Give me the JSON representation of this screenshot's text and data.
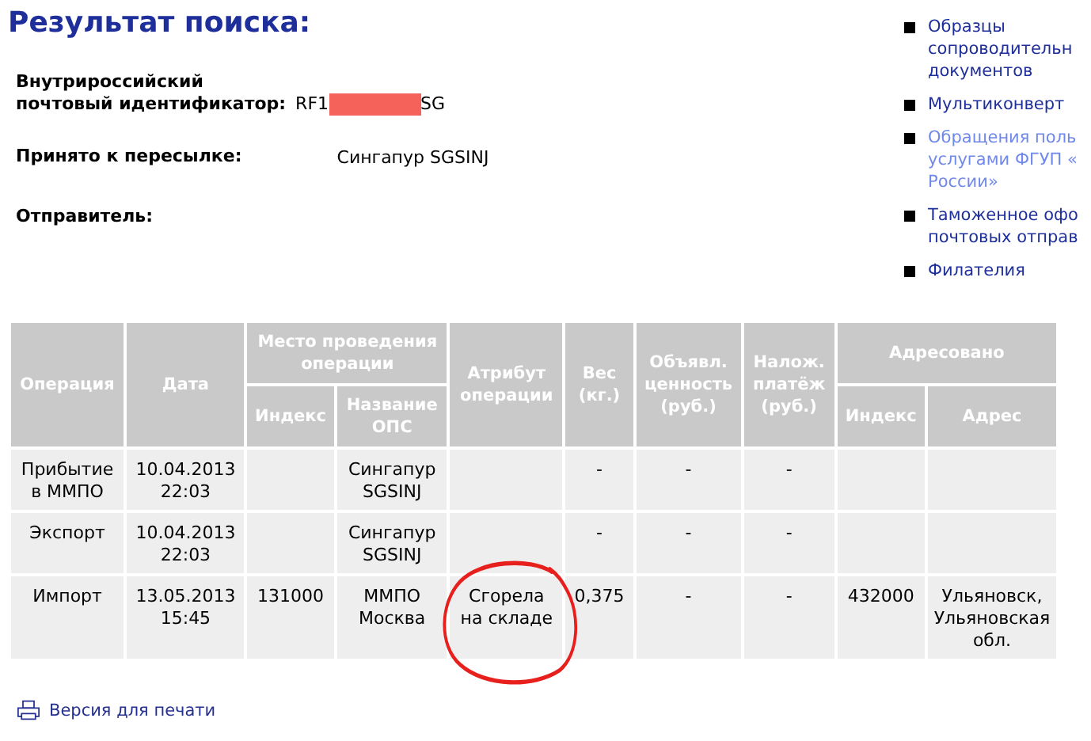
{
  "title": "Результат поиска:",
  "identifier": {
    "label": "Внутрироссийский\nпочтовый идентификатор:",
    "prefix": "RF1",
    "suffix": "SG"
  },
  "accepted": {
    "label": "Принято к пересылке:",
    "value": "Сингапур SGSINJ"
  },
  "sender": {
    "label": "Отправитель:"
  },
  "table": {
    "columns": [
      {
        "label": "Операция",
        "grouped": false
      },
      {
        "label": "Дата",
        "grouped": false
      },
      {
        "label": "Индекс",
        "grouped": true
      },
      {
        "label": "Название\nОПС",
        "grouped": true
      },
      {
        "label": "Атрибут\nоперации",
        "grouped": false
      },
      {
        "label": "Вес\n(кг.)",
        "grouped": false
      },
      {
        "label": "Объявл.\nценность\n(руб.)",
        "grouped": false
      },
      {
        "label": "Налож.\nплатёж\n(руб.)",
        "grouped": false
      },
      {
        "label": "Индекс",
        "grouped": true
      },
      {
        "label": "Адрес",
        "grouped": true
      }
    ],
    "column_groups": [
      {
        "label": "Место проведения\nоперации"
      },
      {
        "label": "Адресовано"
      }
    ],
    "rows": [
      {
        "cells": [
          "Прибытие\nв ММПО",
          "10.04.2013\n22:03",
          null,
          "Сингапур\nSGSINJ",
          null,
          "-",
          "-",
          "-",
          null,
          null
        ]
      },
      {
        "cells": [
          "Экспорт",
          "10.04.2013\n22:03",
          null,
          "Сингапур\nSGSINJ",
          null,
          "-",
          "-",
          "-",
          null,
          null
        ]
      },
      {
        "cells": [
          "Импорт",
          "13.05.2013\n15:45",
          "131000",
          "ММПО\nМосква",
          "Сгорела\nна складе",
          "0,375",
          "-",
          "-",
          "432000",
          "Ульяновск,\nУльяновская\nобл."
        ]
      }
    ]
  },
  "print_link": "Версия для печати",
  "sidebar": {
    "items": [
      {
        "text": "Образцы\nсопроводительн\nдокументов",
        "visited": false
      },
      {
        "text": "Мультиконверт",
        "visited": false
      },
      {
        "text": "Обращения поль\nуслугами ФГУП «\nРоссии»",
        "visited": true
      },
      {
        "text": "Таможенное офо\nпочтовых отправ",
        "visited": false
      },
      {
        "text": "Филателия",
        "visited": false
      }
    ]
  }
}
